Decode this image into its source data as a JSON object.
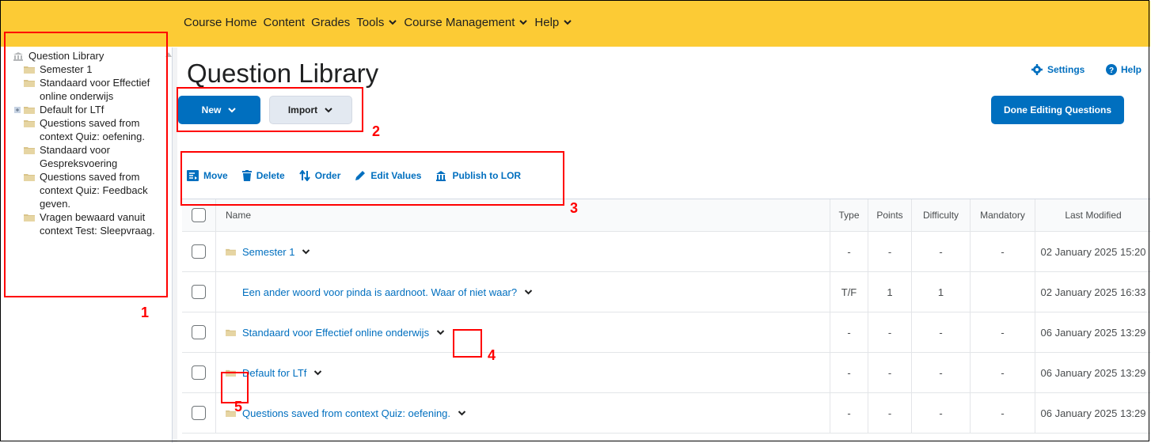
{
  "nav": {
    "items": [
      {
        "label": "Course Home",
        "dropdown": false
      },
      {
        "label": "Content",
        "dropdown": false
      },
      {
        "label": "Grades",
        "dropdown": false
      },
      {
        "label": "Tools",
        "dropdown": true
      },
      {
        "label": "Course Management",
        "dropdown": true
      },
      {
        "label": "Help",
        "dropdown": true
      }
    ]
  },
  "tree": {
    "root": "Question Library",
    "items": [
      "Semester 1",
      "Standaard voor Effectief online onderwijs",
      "Default for LTf",
      "Questions saved from context Quiz: oefening.",
      "Standaard voor Gespreksvoering",
      "Questions saved from context Quiz: Feedback geven.",
      "Vragen bewaard vanuit context Test: Sleepvraag."
    ]
  },
  "header": {
    "title": "Question Library",
    "settings": "Settings",
    "help": "Help",
    "new_label": "New",
    "import_label": "Import",
    "done_label": "Done Editing Questions"
  },
  "toolbar": {
    "move": "Move",
    "delete": "Delete",
    "order": "Order",
    "edit_values": "Edit Values",
    "publish": "Publish to LOR"
  },
  "table": {
    "columns": {
      "name": "Name",
      "type": "Type",
      "points": "Points",
      "difficulty": "Difficulty",
      "mandatory": "Mandatory",
      "modified": "Last Modified"
    },
    "rows": [
      {
        "name": "Semester 1",
        "type": "-",
        "points": "-",
        "difficulty": "-",
        "mandatory": "-",
        "modified": "02 January 2025 15:20"
      },
      {
        "name": "Een ander woord voor pinda is aardnoot. Waar of niet waar?",
        "type": "T/F",
        "points": "1",
        "difficulty": "1",
        "mandatory": "",
        "modified": "02 January 2025 16:33"
      },
      {
        "name": "Standaard voor Effectief online onderwijs",
        "type": "-",
        "points": "-",
        "difficulty": "-",
        "mandatory": "-",
        "modified": "06 January 2025 13:29"
      },
      {
        "name": "Default for LTf",
        "type": "-",
        "points": "-",
        "difficulty": "-",
        "mandatory": "-",
        "modified": "06 January 2025 13:29"
      },
      {
        "name": "Questions saved from context Quiz: oefening.",
        "type": "-",
        "points": "-",
        "difficulty": "-",
        "mandatory": "-",
        "modified": "06 January 2025 13:29"
      }
    ]
  },
  "annotations": [
    "1",
    "2",
    "3",
    "4",
    "5"
  ],
  "colors": {
    "nav_bg": "#fccb35",
    "primary": "#006fbf",
    "annotation": "#ff0000"
  }
}
